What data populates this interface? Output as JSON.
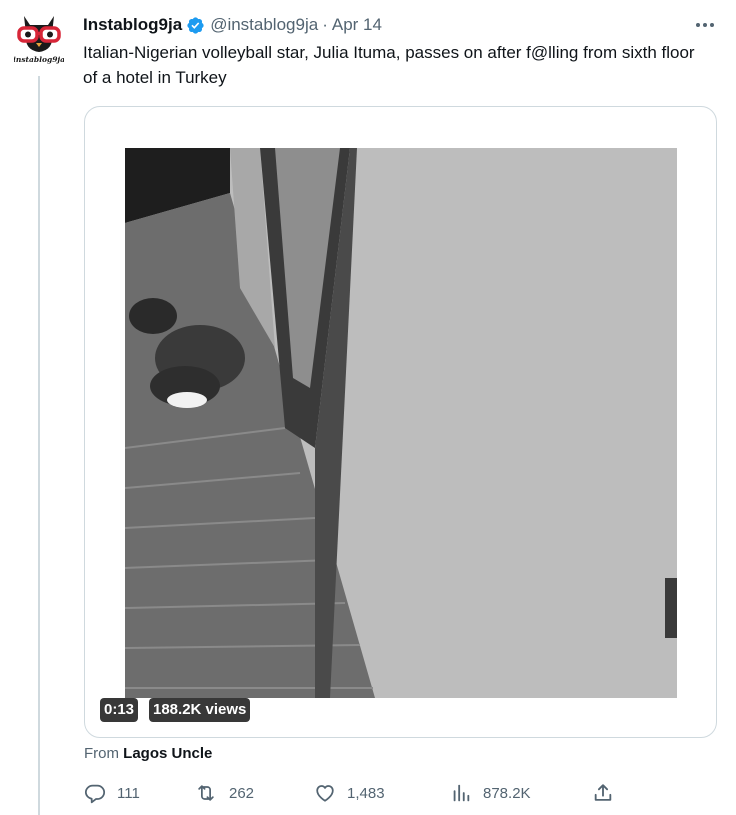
{
  "tweet": {
    "display_name": "Instablog9ja",
    "handle": "@instablog9ja",
    "separator": "·",
    "date": "Apr 14",
    "text": "Italian-Nigerian volleyball star, Julia Ituma, passes on after f@lling from sixth floor  of a hotel in Turkey",
    "avatar_text": "instablog9ja",
    "avatar_icon": "owl-logo-icon",
    "verified_icon": "verified-badge-icon",
    "more_icon": "more-options-icon"
  },
  "media": {
    "duration": "0:13",
    "views": "188.2K views"
  },
  "attribution": {
    "prefix": "From",
    "source": "Lagos Uncle"
  },
  "actions": {
    "replies": "111",
    "retweets": "262",
    "likes": "1,483",
    "views": "878.2K"
  },
  "colors": {
    "verified": "#1d9bf0",
    "secondary_text": "#536471",
    "border": "#cfd9de",
    "avatar_accent": "#d72638"
  }
}
